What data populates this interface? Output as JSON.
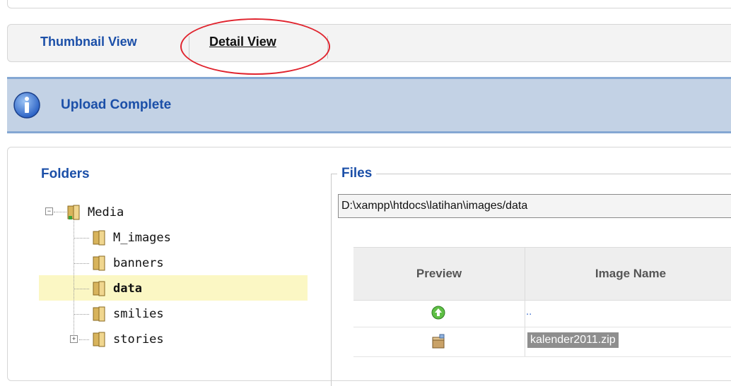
{
  "tabs": {
    "thumbnail": "Thumbnail View",
    "detail": "Detail View"
  },
  "message": {
    "text": "Upload Complete",
    "icon": "info-icon"
  },
  "folders": {
    "heading": "Folders",
    "root": "Media",
    "children": [
      "M_images",
      "banners",
      "data",
      "smilies",
      "stories"
    ],
    "selected": "data"
  },
  "files": {
    "heading": "Files",
    "path": "D:\\xampp\\htdocs\\latihan\\images/data",
    "columns": [
      "Preview",
      "Image Name"
    ],
    "rows": [
      {
        "preview": "up-arrow-icon",
        "name": ".."
      },
      {
        "preview": "archive-icon",
        "name": "kalender2011.zip"
      }
    ]
  },
  "colors": {
    "accent": "#1b4fa8",
    "message_bg": "#c3d2e5",
    "highlight": "#fbf7c4",
    "annotation": "#e0242e"
  }
}
